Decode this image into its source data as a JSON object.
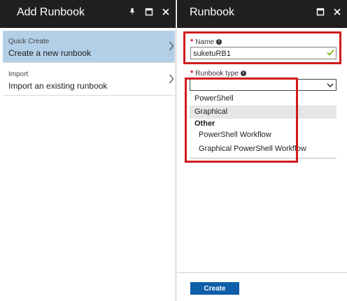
{
  "left_blade": {
    "title": "Add Runbook",
    "items": [
      {
        "category": "Quick Create",
        "description": "Create a new runbook"
      },
      {
        "category": "Import",
        "description": "Import an existing runbook"
      }
    ]
  },
  "right_blade": {
    "title": "Runbook",
    "name_field": {
      "label": "Name",
      "value": "suketuRB1"
    },
    "type_field": {
      "label": "Runbook type",
      "selected": "",
      "options": [
        "PowerShell",
        "Graphical"
      ],
      "group_label": "Other",
      "group_options": [
        "PowerShell Workflow",
        "Graphical PowerShell Workflow"
      ]
    },
    "create_label": "Create"
  },
  "icons": [
    "pin-icon",
    "maximize-icon",
    "close-icon",
    "info-icon",
    "checkmark-icon",
    "chevron-right-icon",
    "chevron-down-icon"
  ],
  "colors": {
    "header_bg": "#1f1f1f",
    "selected_item_bg": "#b3cfe8",
    "highlight_box": "#d11a1a",
    "create_button": "#0f5ea8",
    "valid_check": "#6bb700",
    "required_asterisk": "#d9112a"
  }
}
